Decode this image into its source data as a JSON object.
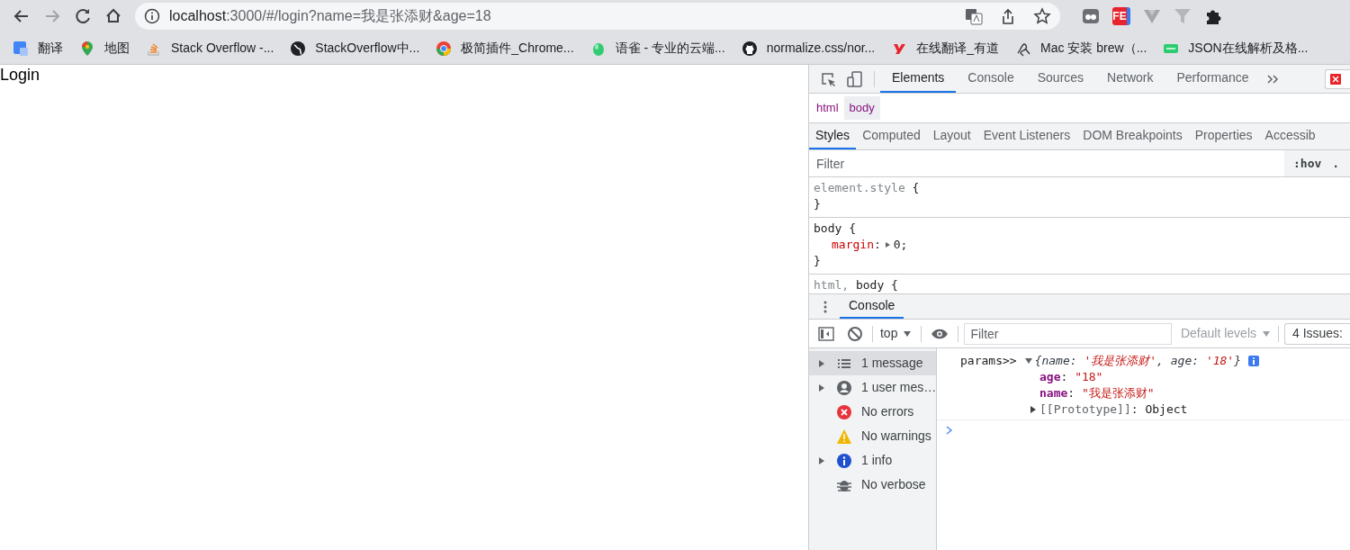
{
  "browser": {
    "back": {
      "disabled": false
    },
    "forward": {
      "disabled": true
    },
    "address": {
      "host": "localhost",
      "rest": ":3000/#/login?name=我是张添财&age=18"
    },
    "extensions": [
      {
        "kind": "ghost"
      },
      {
        "kind": "fe",
        "text": "FE"
      },
      {
        "kind": "vue"
      },
      {
        "kind": "funnel"
      },
      {
        "kind": "puzzle"
      }
    ],
    "bookmarks": [
      {
        "kind": "translate",
        "label": "翻译"
      },
      {
        "kind": "maps",
        "label": "地图"
      },
      {
        "kind": "stack",
        "label": "Stack Overflow -..."
      },
      {
        "kind": "globe",
        "label": "StackOverflow中..."
      },
      {
        "kind": "chrome",
        "label": "极简插件_Chrome..."
      },
      {
        "kind": "yuque",
        "label": "语雀 - 专业的云端..."
      },
      {
        "kind": "github",
        "label": "normalize.css/nor..."
      },
      {
        "kind": "youdao",
        "label": "在线翻译_有道"
      },
      {
        "kind": "mac",
        "label": "Mac 安装 brew（..."
      },
      {
        "kind": "json",
        "label": "JSON在线解析及格..."
      }
    ]
  },
  "page": {
    "text": "Login"
  },
  "devtools": {
    "tabs": [
      {
        "label": "Elements",
        "selected": true
      },
      {
        "label": "Console",
        "selected": false
      },
      {
        "label": "Sources",
        "selected": false
      },
      {
        "label": "Network",
        "selected": false
      },
      {
        "label": "Performance",
        "selected": false
      }
    ],
    "breadcrumbs": [
      {
        "label": "html",
        "selected": false
      },
      {
        "label": "body",
        "selected": true
      }
    ],
    "sidebar_tabs": [
      {
        "label": "Styles",
        "selected": true
      },
      {
        "label": "Computed",
        "selected": false
      },
      {
        "label": "Layout",
        "selected": false
      },
      {
        "label": "Event Listeners",
        "selected": false
      },
      {
        "label": "DOM Breakpoints",
        "selected": false
      },
      {
        "label": "Properties",
        "selected": false
      },
      {
        "label": "Accessib",
        "selected": false
      }
    ],
    "styles_filter": {
      "placeholder": "Filter",
      "hov": ":hov",
      "cls": "."
    },
    "rules": [
      {
        "lines": [
          {
            "kind": "selector",
            "tokens": [
              {
                "kind": "dim",
                "text": "element.style"
              },
              {
                "kind": "plain",
                "text": " {"
              }
            ]
          },
          {
            "kind": "close",
            "tokens": [
              {
                "kind": "plain",
                "text": "}"
              }
            ]
          }
        ]
      },
      {
        "lines": [
          {
            "kind": "selector",
            "tokens": [
              {
                "kind": "plain",
                "text": "body {"
              }
            ]
          },
          {
            "kind": "declaration",
            "tokens": [
              {
                "kind": "prop",
                "text": "margin"
              },
              {
                "kind": "plain",
                "text": ":"
              },
              {
                "kind": "arrow"
              },
              {
                "kind": "plain",
                "text": "0;"
              }
            ]
          },
          {
            "kind": "close",
            "tokens": [
              {
                "kind": "plain",
                "text": "}"
              }
            ]
          }
        ]
      },
      {
        "lines": [
          {
            "kind": "selector",
            "tokens": [
              {
                "kind": "dim",
                "text": "html,"
              },
              {
                "kind": "plain",
                "text": " body {"
              }
            ]
          }
        ]
      }
    ],
    "drawer_tabs": [
      {
        "label": "Console",
        "selected": true
      }
    ],
    "console_toolbar": {
      "context": "top",
      "filter_placeholder": "Filter",
      "levels": "Default levels",
      "issues": "4 Issues:"
    },
    "console_sidebar": [
      {
        "kind": "list",
        "label": "1 message",
        "expandable": true,
        "selected": true
      },
      {
        "kind": "user",
        "label": "1 user mes…",
        "expandable": true,
        "selected": false
      },
      {
        "kind": "error",
        "label": "No errors",
        "expandable": false,
        "selected": false
      },
      {
        "kind": "warning",
        "label": "No warnings",
        "expandable": false,
        "selected": false
      },
      {
        "kind": "info",
        "label": "1 info",
        "expandable": true,
        "selected": false
      },
      {
        "kind": "verbose",
        "label": "No verbose",
        "expandable": false,
        "selected": false
      }
    ],
    "messages": [
      {
        "prefix": "params>>",
        "expanded": true,
        "preview": [
          {
            "kind": "ikey",
            "text": "{name: "
          },
          {
            "kind": "istr",
            "text": "'我是张添财'"
          },
          {
            "kind": "ikey",
            "text": ", age: "
          },
          {
            "kind": "istr",
            "text": "'18'"
          },
          {
            "kind": "ikey",
            "text": "}"
          }
        ],
        "children": [
          {
            "tokens": [
              {
                "kind": "key",
                "text": "age"
              },
              {
                "kind": "plain",
                "text": ": "
              },
              {
                "kind": "str",
                "text": "\"18\""
              }
            ]
          },
          {
            "tokens": [
              {
                "kind": "key",
                "text": "name"
              },
              {
                "kind": "plain",
                "text": ": "
              },
              {
                "kind": "str",
                "text": "\"我是张添财\""
              }
            ]
          },
          {
            "expanded": false,
            "tokens": [
              {
                "kind": "dim2",
                "text": "[[Prototype]]"
              },
              {
                "kind": "plain",
                "text": ": Object"
              }
            ]
          }
        ]
      }
    ]
  }
}
